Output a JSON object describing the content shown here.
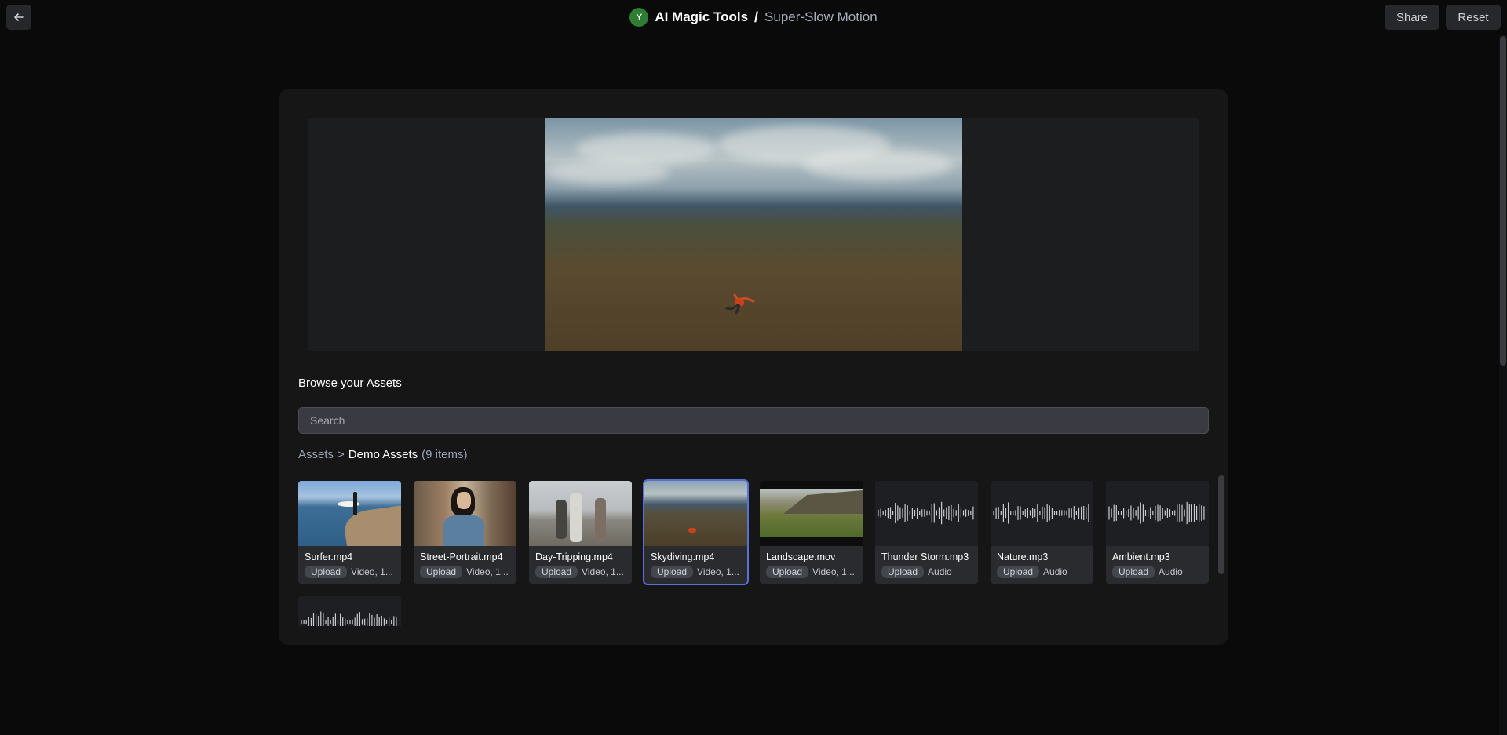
{
  "header": {
    "avatar_letter": "Y",
    "app_name": "AI Magic Tools",
    "separator": "/",
    "tool_name": "Super-Slow Motion",
    "share_label": "Share",
    "reset_label": "Reset"
  },
  "browser": {
    "title": "Browse your Assets",
    "search_placeholder": "Search",
    "breadcrumb": {
      "root": "Assets",
      "arrow": ">",
      "current": "Demo Assets",
      "count": "(9 items)"
    }
  },
  "assets": [
    {
      "name": "Surfer.mp4",
      "badge": "Upload",
      "meta": "Video, 1..."
    },
    {
      "name": "Street-Portrait.mp4",
      "badge": "Upload",
      "meta": "Video, 1..."
    },
    {
      "name": "Day-Tripping.mp4",
      "badge": "Upload",
      "meta": "Video, 1..."
    },
    {
      "name": "Skydiving.mp4",
      "badge": "Upload",
      "meta": "Video, 1..."
    },
    {
      "name": "Landscape.mov",
      "badge": "Upload",
      "meta": "Video, 1..."
    },
    {
      "name": "Thunder Storm.mp3",
      "badge": "Upload",
      "meta": "Audio"
    },
    {
      "name": "Nature.mp3",
      "badge": "Upload",
      "meta": "Audio"
    },
    {
      "name": "Ambient.mp3",
      "badge": "Upload",
      "meta": "Audio"
    }
  ],
  "selected_asset": "Skydiving.mp4",
  "colors": {
    "accent": "#5672d6",
    "avatar": "#2f7d32",
    "panel": "#161617"
  }
}
